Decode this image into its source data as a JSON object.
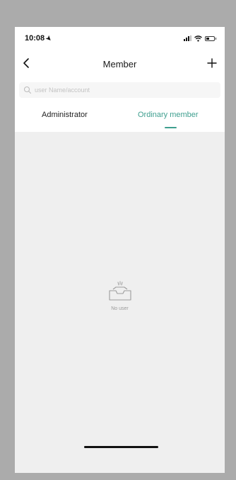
{
  "status_bar": {
    "time": "10:08",
    "location_glyph": "➤",
    "icons": [
      "signal-icon",
      "wifi-icon",
      "battery-icon"
    ]
  },
  "header": {
    "title": "Member",
    "back_icon": "chevron-left-icon",
    "add_icon": "plus-icon"
  },
  "search": {
    "placeholder": "user Name/account",
    "value": "",
    "icon": "search-icon"
  },
  "tabs": [
    {
      "label": "Administrator",
      "active": false
    },
    {
      "label": "Ordinary member",
      "active": true
    }
  ],
  "empty_state": {
    "icon": "empty-inbox-icon",
    "text": "No user"
  },
  "colors": {
    "accent": "#3f9f8f",
    "background": "#efefef",
    "outer_frame": "#ababab",
    "surface": "#ffffff"
  }
}
